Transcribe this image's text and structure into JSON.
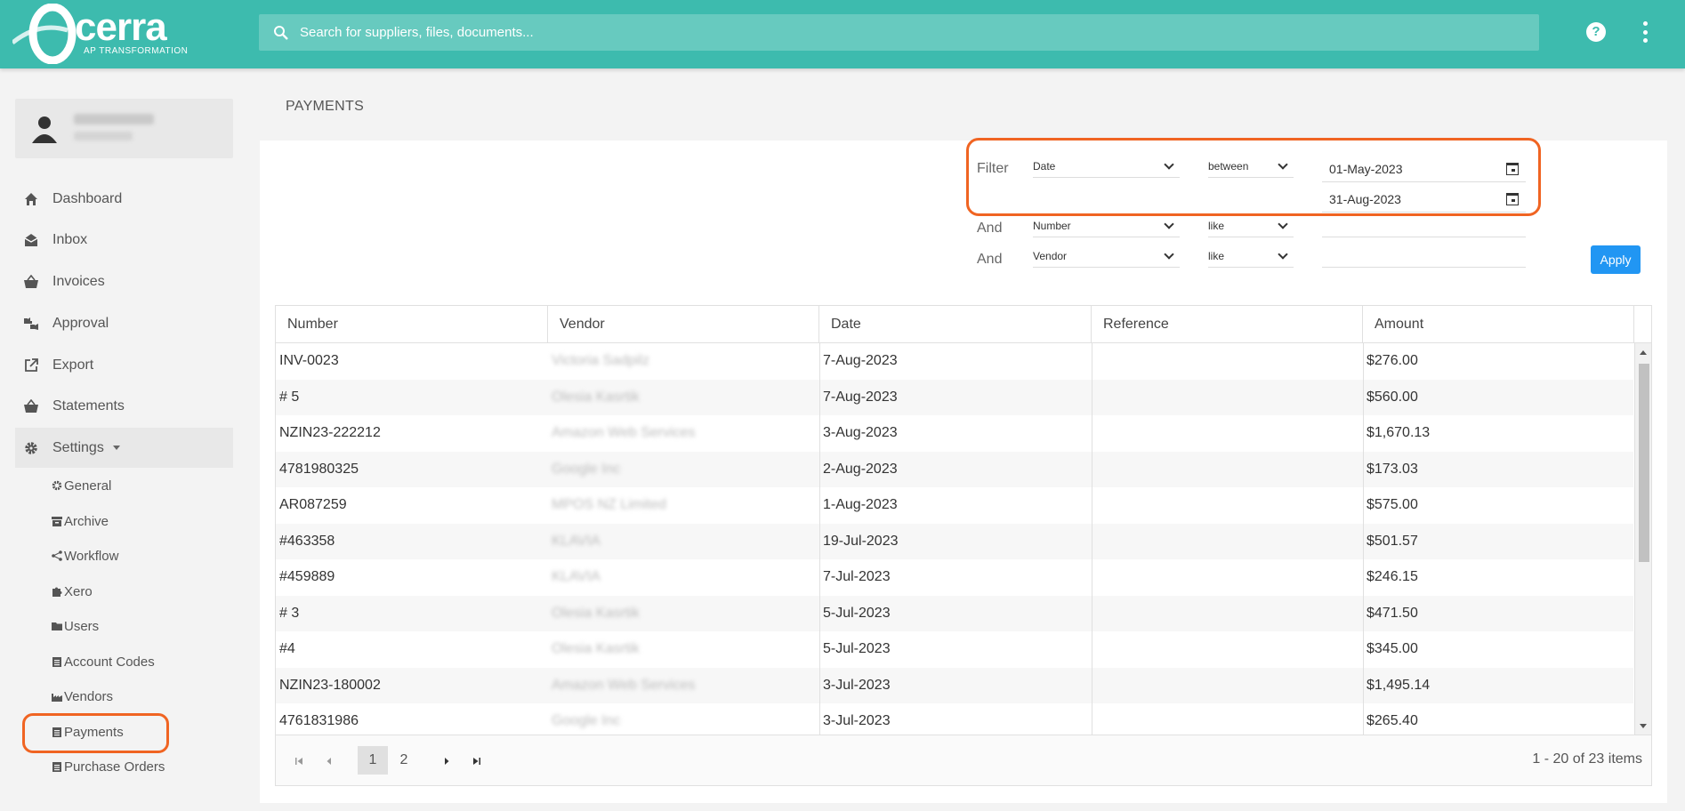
{
  "brand": {
    "name": "cerra",
    "tagline": "AP TRANSFORMATION"
  },
  "search": {
    "placeholder": "Search for suppliers, files, documents..."
  },
  "header": {
    "help_icon": "?",
    "menu_icon": "kebab-menu-icon"
  },
  "sidebar": {
    "items": [
      {
        "label": "Dashboard",
        "icon": "home-icon"
      },
      {
        "label": "Inbox",
        "icon": "envelope-open-icon"
      },
      {
        "label": "Invoices",
        "icon": "basket-icon"
      },
      {
        "label": "Approval",
        "icon": "thumbs-icon"
      },
      {
        "label": "Export",
        "icon": "external-link-icon"
      },
      {
        "label": "Statements",
        "icon": "basket-icon"
      },
      {
        "label": "Settings",
        "icon": "gear-icon"
      }
    ],
    "settings_items": [
      {
        "label": "General",
        "icon": "gear-icon"
      },
      {
        "label": "Archive",
        "icon": "archive-icon"
      },
      {
        "label": "Workflow",
        "icon": "share-icon"
      },
      {
        "label": "Xero",
        "icon": "puzzle-icon"
      },
      {
        "label": "Users",
        "icon": "folder-icon"
      },
      {
        "label": "Account Codes",
        "icon": "clipboard-icon"
      },
      {
        "label": "Vendors",
        "icon": "industry-icon"
      },
      {
        "label": "Payments",
        "icon": "list-icon"
      },
      {
        "label": "Purchase Orders",
        "icon": "clipboard-icon"
      }
    ]
  },
  "page": {
    "title": "PAYMENTS"
  },
  "filters": {
    "filter_label": "Filter",
    "and_label": "And",
    "rows": [
      {
        "field": "Date",
        "operator": "between",
        "value_from": "01-May-2023",
        "value_to": "31-Aug-2023"
      },
      {
        "field": "Number",
        "operator": "like",
        "value": ""
      },
      {
        "field": "Vendor",
        "operator": "like",
        "value": ""
      }
    ],
    "apply_label": "Apply"
  },
  "grid": {
    "columns": [
      "Number",
      "Vendor",
      "Date",
      "Reference",
      "Amount"
    ],
    "rows": [
      {
        "number": "INV-0023",
        "vendor": "Victoria Sadpilz",
        "date": "7-Aug-2023",
        "reference": "",
        "amount": "$276.00"
      },
      {
        "number": "# 5",
        "vendor": "Olesia Kasrtik",
        "date": "7-Aug-2023",
        "reference": "",
        "amount": "$560.00"
      },
      {
        "number": "NZIN23-222212",
        "vendor": "Amazon Web Services",
        "date": "3-Aug-2023",
        "reference": "",
        "amount": "$1,670.13"
      },
      {
        "number": "4781980325",
        "vendor": "Google Inc",
        "date": "2-Aug-2023",
        "reference": "",
        "amount": "$173.03"
      },
      {
        "number": "AR087259",
        "vendor": "MPOS NZ Limited",
        "date": "1-Aug-2023",
        "reference": "",
        "amount": "$575.00"
      },
      {
        "number": "#463358",
        "vendor": "KLAVIA",
        "date": "19-Jul-2023",
        "reference": "",
        "amount": "$501.57"
      },
      {
        "number": "#459889",
        "vendor": "KLAVIA",
        "date": "7-Jul-2023",
        "reference": "",
        "amount": "$246.15"
      },
      {
        "number": "# 3",
        "vendor": "Olesia Kasrtik",
        "date": "5-Jul-2023",
        "reference": "",
        "amount": "$471.50"
      },
      {
        "number": "#4",
        "vendor": "Olesia Kasrtik",
        "date": "5-Jul-2023",
        "reference": "",
        "amount": "$345.00"
      },
      {
        "number": "NZIN23-180002",
        "vendor": "Amazon Web Services",
        "date": "3-Jul-2023",
        "reference": "",
        "amount": "$1,495.14"
      },
      {
        "number": "4761831986",
        "vendor": "Google Inc",
        "date": "3-Jul-2023",
        "reference": "",
        "amount": "$265.40"
      }
    ],
    "pager": {
      "pages": [
        "1",
        "2"
      ],
      "current": "1",
      "info": "1 - 20 of 23 items"
    }
  },
  "colors": {
    "brand": "#3dbbae",
    "accent": "#2196f3",
    "highlight": "#f06422"
  }
}
